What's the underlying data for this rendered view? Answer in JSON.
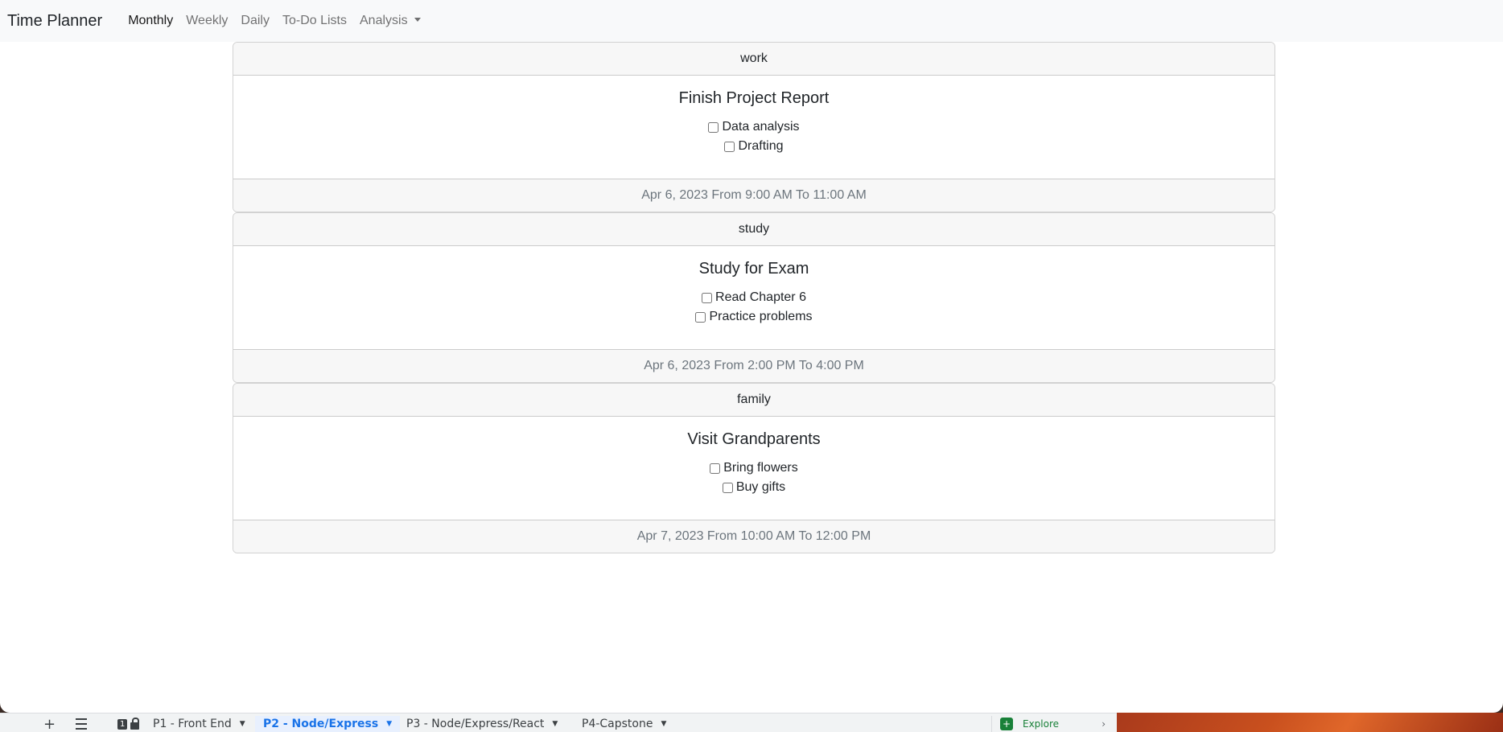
{
  "navbar": {
    "brand": "Time Planner",
    "links": [
      "Monthly",
      "Weekly",
      "Daily",
      "To-Do Lists"
    ],
    "dropdown_label": "Analysis",
    "active": "Monthly"
  },
  "events": [
    {
      "category": "work",
      "title": "Finish Project Report",
      "tasks": [
        "Data analysis",
        "Drafting"
      ],
      "schedule": "Apr 6, 2023 From 9:00 AM To 11:00 AM"
    },
    {
      "category": "study",
      "title": "Study for Exam",
      "tasks": [
        "Read Chapter 6",
        "Practice problems"
      ],
      "schedule": "Apr 6, 2023 From 2:00 PM To 4:00 PM"
    },
    {
      "category": "family",
      "title": "Visit Grandparents",
      "tasks": [
        "Bring flowers",
        "Buy gifts"
      ],
      "schedule": "Apr 7, 2023 From 10:00 AM To 12:00 PM"
    }
  ],
  "sheet_bar": {
    "add_symbol": "+",
    "badge_number": "1",
    "tabs": [
      "P1 - Front End",
      "P2 - Node/Express",
      "P3 - Node/Express/React",
      "P4-Capstone"
    ],
    "active_tab": "P2 - Node/Express",
    "explore_label": "Explore",
    "explore_glyph": "+",
    "chevron": "›",
    "caret": "▼"
  },
  "colors": {
    "navbar_bg": "#f8f9fa",
    "card_header_bg": "#f7f7f7",
    "footer_text": "#6c757d",
    "active_sheet_tab": "#1a73e8",
    "explore_green": "#188038"
  }
}
